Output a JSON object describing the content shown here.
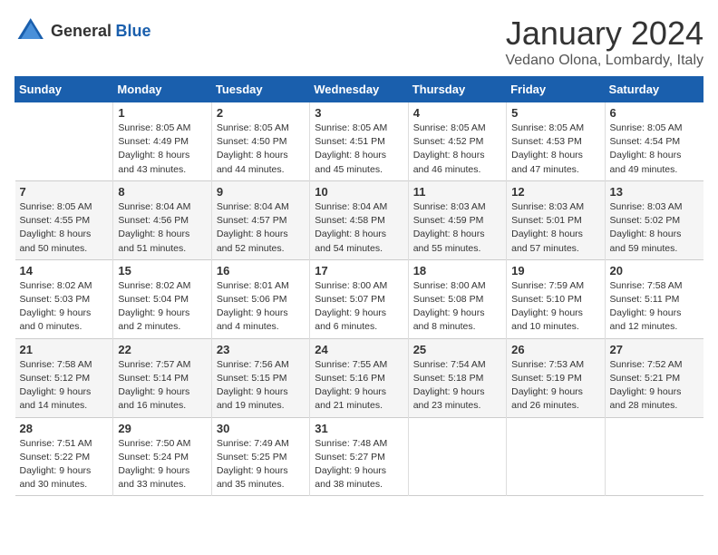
{
  "logo": {
    "general": "General",
    "blue": "Blue"
  },
  "header": {
    "month": "January 2024",
    "location": "Vedano Olona, Lombardy, Italy"
  },
  "weekdays": [
    "Sunday",
    "Monday",
    "Tuesday",
    "Wednesday",
    "Thursday",
    "Friday",
    "Saturday"
  ],
  "weeks": [
    [
      {
        "day": "",
        "info": ""
      },
      {
        "day": "1",
        "info": "Sunrise: 8:05 AM\nSunset: 4:49 PM\nDaylight: 8 hours\nand 43 minutes."
      },
      {
        "day": "2",
        "info": "Sunrise: 8:05 AM\nSunset: 4:50 PM\nDaylight: 8 hours\nand 44 minutes."
      },
      {
        "day": "3",
        "info": "Sunrise: 8:05 AM\nSunset: 4:51 PM\nDaylight: 8 hours\nand 45 minutes."
      },
      {
        "day": "4",
        "info": "Sunrise: 8:05 AM\nSunset: 4:52 PM\nDaylight: 8 hours\nand 46 minutes."
      },
      {
        "day": "5",
        "info": "Sunrise: 8:05 AM\nSunset: 4:53 PM\nDaylight: 8 hours\nand 47 minutes."
      },
      {
        "day": "6",
        "info": "Sunrise: 8:05 AM\nSunset: 4:54 PM\nDaylight: 8 hours\nand 49 minutes."
      }
    ],
    [
      {
        "day": "7",
        "info": "Sunrise: 8:05 AM\nSunset: 4:55 PM\nDaylight: 8 hours\nand 50 minutes."
      },
      {
        "day": "8",
        "info": "Sunrise: 8:04 AM\nSunset: 4:56 PM\nDaylight: 8 hours\nand 51 minutes."
      },
      {
        "day": "9",
        "info": "Sunrise: 8:04 AM\nSunset: 4:57 PM\nDaylight: 8 hours\nand 52 minutes."
      },
      {
        "day": "10",
        "info": "Sunrise: 8:04 AM\nSunset: 4:58 PM\nDaylight: 8 hours\nand 54 minutes."
      },
      {
        "day": "11",
        "info": "Sunrise: 8:03 AM\nSunset: 4:59 PM\nDaylight: 8 hours\nand 55 minutes."
      },
      {
        "day": "12",
        "info": "Sunrise: 8:03 AM\nSunset: 5:01 PM\nDaylight: 8 hours\nand 57 minutes."
      },
      {
        "day": "13",
        "info": "Sunrise: 8:03 AM\nSunset: 5:02 PM\nDaylight: 8 hours\nand 59 minutes."
      }
    ],
    [
      {
        "day": "14",
        "info": "Sunrise: 8:02 AM\nSunset: 5:03 PM\nDaylight: 9 hours\nand 0 minutes."
      },
      {
        "day": "15",
        "info": "Sunrise: 8:02 AM\nSunset: 5:04 PM\nDaylight: 9 hours\nand 2 minutes."
      },
      {
        "day": "16",
        "info": "Sunrise: 8:01 AM\nSunset: 5:06 PM\nDaylight: 9 hours\nand 4 minutes."
      },
      {
        "day": "17",
        "info": "Sunrise: 8:00 AM\nSunset: 5:07 PM\nDaylight: 9 hours\nand 6 minutes."
      },
      {
        "day": "18",
        "info": "Sunrise: 8:00 AM\nSunset: 5:08 PM\nDaylight: 9 hours\nand 8 minutes."
      },
      {
        "day": "19",
        "info": "Sunrise: 7:59 AM\nSunset: 5:10 PM\nDaylight: 9 hours\nand 10 minutes."
      },
      {
        "day": "20",
        "info": "Sunrise: 7:58 AM\nSunset: 5:11 PM\nDaylight: 9 hours\nand 12 minutes."
      }
    ],
    [
      {
        "day": "21",
        "info": "Sunrise: 7:58 AM\nSunset: 5:12 PM\nDaylight: 9 hours\nand 14 minutes."
      },
      {
        "day": "22",
        "info": "Sunrise: 7:57 AM\nSunset: 5:14 PM\nDaylight: 9 hours\nand 16 minutes."
      },
      {
        "day": "23",
        "info": "Sunrise: 7:56 AM\nSunset: 5:15 PM\nDaylight: 9 hours\nand 19 minutes."
      },
      {
        "day": "24",
        "info": "Sunrise: 7:55 AM\nSunset: 5:16 PM\nDaylight: 9 hours\nand 21 minutes."
      },
      {
        "day": "25",
        "info": "Sunrise: 7:54 AM\nSunset: 5:18 PM\nDaylight: 9 hours\nand 23 minutes."
      },
      {
        "day": "26",
        "info": "Sunrise: 7:53 AM\nSunset: 5:19 PM\nDaylight: 9 hours\nand 26 minutes."
      },
      {
        "day": "27",
        "info": "Sunrise: 7:52 AM\nSunset: 5:21 PM\nDaylight: 9 hours\nand 28 minutes."
      }
    ],
    [
      {
        "day": "28",
        "info": "Sunrise: 7:51 AM\nSunset: 5:22 PM\nDaylight: 9 hours\nand 30 minutes."
      },
      {
        "day": "29",
        "info": "Sunrise: 7:50 AM\nSunset: 5:24 PM\nDaylight: 9 hours\nand 33 minutes."
      },
      {
        "day": "30",
        "info": "Sunrise: 7:49 AM\nSunset: 5:25 PM\nDaylight: 9 hours\nand 35 minutes."
      },
      {
        "day": "31",
        "info": "Sunrise: 7:48 AM\nSunset: 5:27 PM\nDaylight: 9 hours\nand 38 minutes."
      },
      {
        "day": "",
        "info": ""
      },
      {
        "day": "",
        "info": ""
      },
      {
        "day": "",
        "info": ""
      }
    ]
  ]
}
